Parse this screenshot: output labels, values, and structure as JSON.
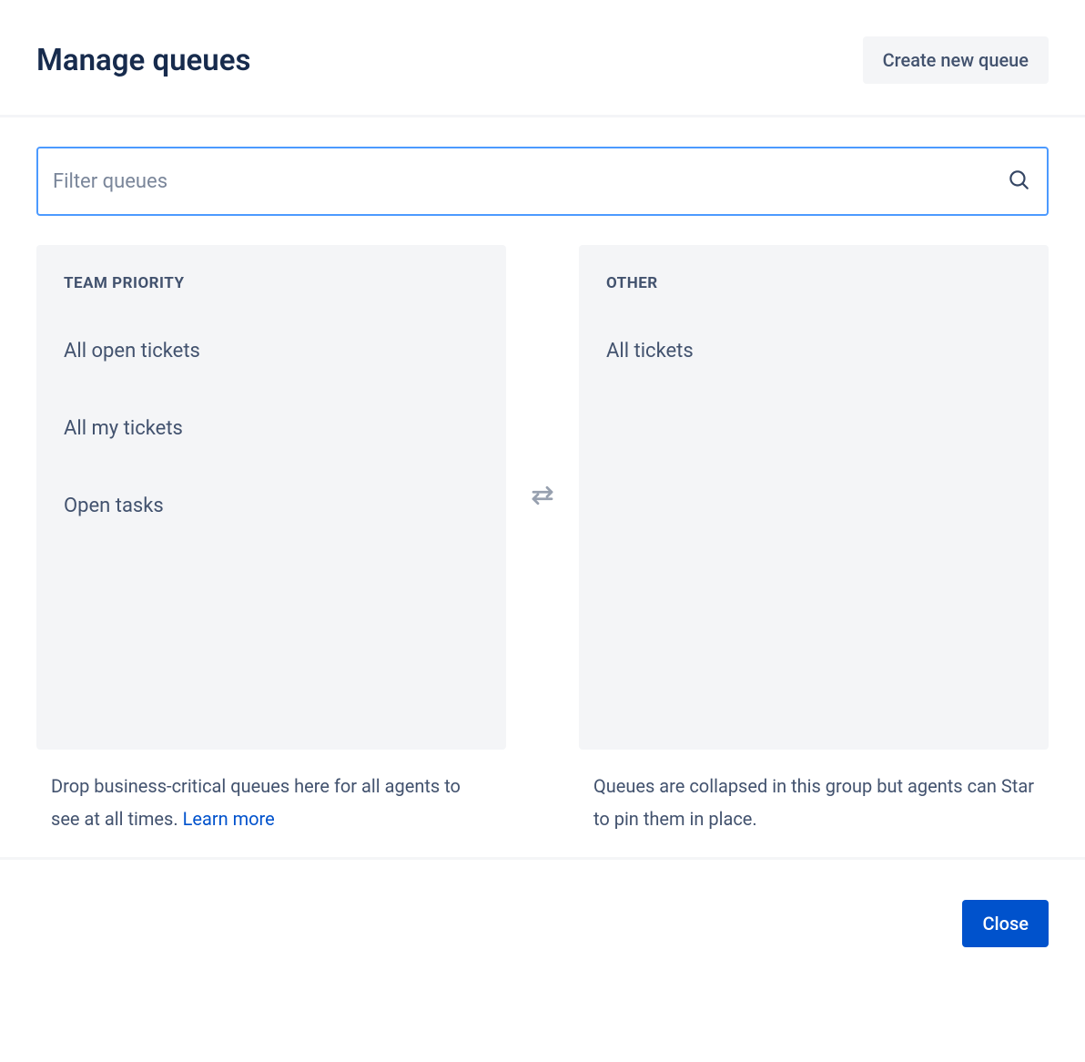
{
  "header": {
    "title": "Manage queues",
    "create_label": "Create new queue"
  },
  "search": {
    "placeholder": "Filter queues",
    "value": ""
  },
  "team_priority": {
    "title": "Team priority",
    "items": [
      "All open tickets",
      "All my tickets",
      "Open tasks"
    ],
    "hint_prefix": "Drop business-critical queues here for all agents to see at all times. ",
    "hint_link": "Learn more"
  },
  "other": {
    "title": "Other",
    "items": [
      "All tickets"
    ],
    "hint": "Queues are collapsed in this group but agents can Star to pin them in place."
  },
  "footer": {
    "close_label": "Close"
  }
}
